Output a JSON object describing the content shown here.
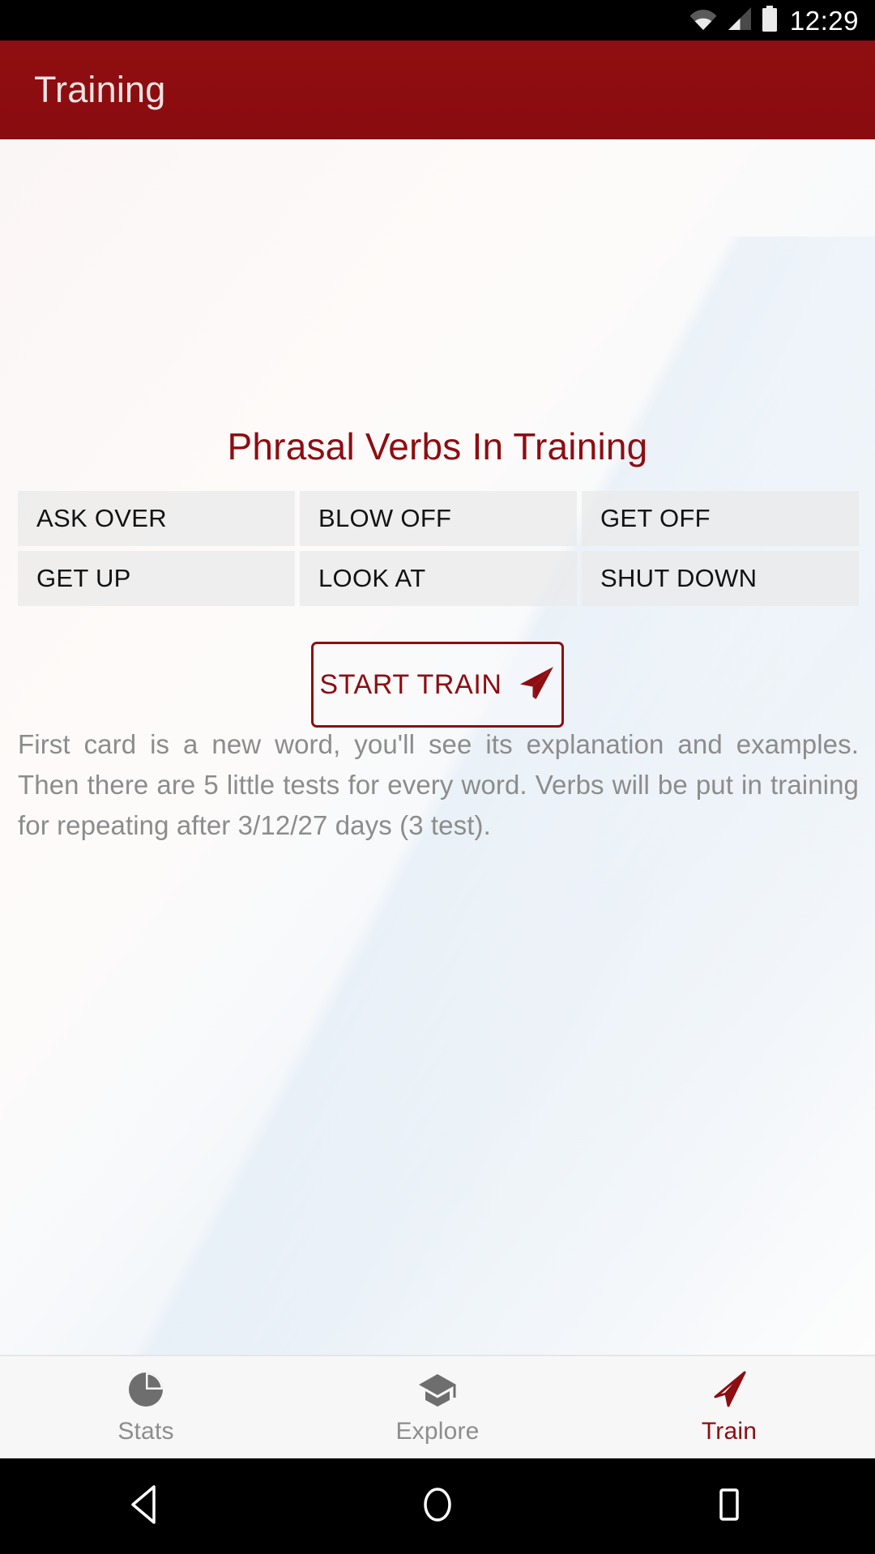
{
  "statusbar": {
    "time": "12:29",
    "icons": [
      "wifi-icon",
      "cellular-signal-icon",
      "battery-icon"
    ]
  },
  "appbar": {
    "title": "Training"
  },
  "main": {
    "headline": "Phrasal Verbs In Training",
    "chips": [
      {
        "label": "ASK OVER"
      },
      {
        "label": "BLOW OFF"
      },
      {
        "label": "GET OFF"
      },
      {
        "label": "GET UP"
      },
      {
        "label": "LOOK AT"
      },
      {
        "label": "SHUT DOWN"
      }
    ],
    "start_button": {
      "label": "START TRAIN",
      "icon": "send-icon"
    },
    "description": "First card is a new word, you'll see its explanation and examples. Then there are 5 little tests for every word. Verbs will be put in training for repeating after 3/12/27 days (3 test)."
  },
  "bottomnav": {
    "items": [
      {
        "label": "Stats",
        "icon": "pie-chart-icon",
        "active": false
      },
      {
        "label": "Explore",
        "icon": "graduation-cap-icon",
        "active": false
      },
      {
        "label": "Train",
        "icon": "send-icon",
        "active": true
      }
    ]
  },
  "sysnav": {
    "back": "back-triangle-icon",
    "home": "home-circle-icon",
    "recents": "recents-square-icon"
  },
  "colors": {
    "brand_red": "#8d0d12",
    "appbar_red": "#8d0d10",
    "chip_gray": "#e9e9e9",
    "muted_text": "#8c8c8c",
    "statusbar_black": "#000000"
  }
}
